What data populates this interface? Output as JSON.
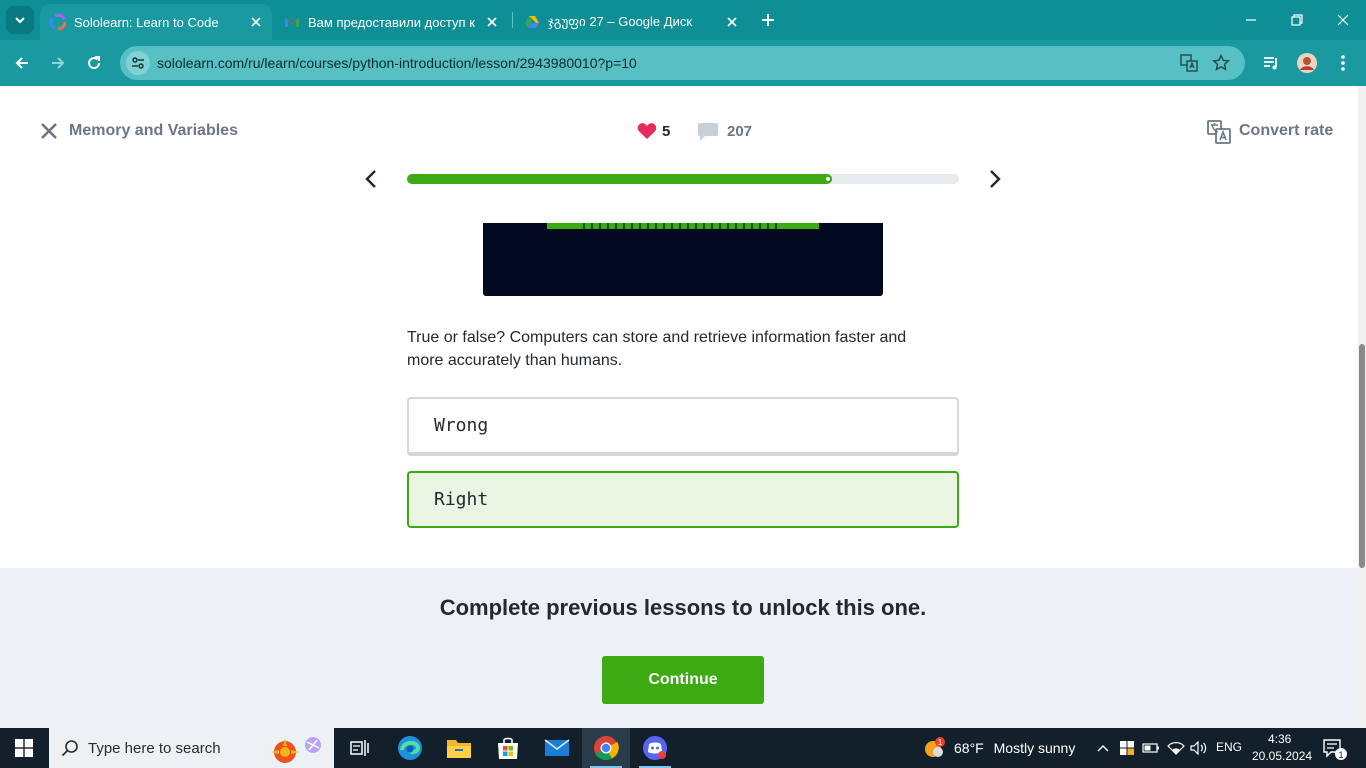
{
  "browser": {
    "tabs": [
      {
        "title": "Sololearn: Learn to Code",
        "active": true,
        "favicon": "sololearn-icon"
      },
      {
        "title": "Вам предоставили доступ к па",
        "active": false,
        "favicon": "gmail-icon"
      },
      {
        "title": "ჯგუფი 27 – Google Диск",
        "active": false,
        "favicon": "google-drive-icon"
      }
    ],
    "url": "sololearn.com/ru/learn/courses/python-introduction/lesson/2943980010?p=10"
  },
  "lesson": {
    "title": "Memory and Variables",
    "hearts": "5",
    "comments": "207",
    "convert_label": "Convert rate",
    "progress": 0.77
  },
  "question": {
    "text": "True or false? Computers can store and retrieve information faster and more accurately than humans.",
    "options": [
      {
        "label": "Wrong",
        "selected": false
      },
      {
        "label": "Right",
        "selected": true
      }
    ]
  },
  "footer": {
    "message": "Complete previous lessons to unlock this one.",
    "continue_label": "Continue"
  },
  "taskbar": {
    "search_placeholder": "Type here to search",
    "weather": {
      "temp": "68°F",
      "condition": "Mostly sunny",
      "badge": "1"
    },
    "language": "ENG",
    "time": "4:36",
    "date": "20.05.2024",
    "notifications": "1"
  },
  "colors": {
    "accent_green": "#3eaa13",
    "chrome_teal": "#1a9aa0",
    "heart_red": "#e52c5a"
  }
}
